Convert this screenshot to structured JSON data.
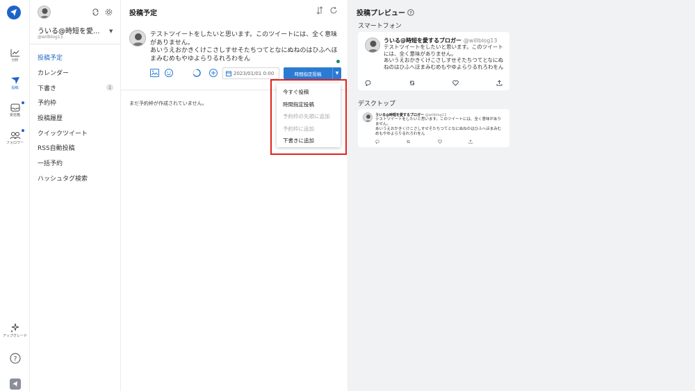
{
  "rail": {
    "items": [
      {
        "label": "分析"
      },
      {
        "label": "投稿"
      },
      {
        "label": "受信箱"
      },
      {
        "label": "フォロワー"
      }
    ],
    "upgrade_label": "アップグレード"
  },
  "sidebar": {
    "account_name": "ういる@時短を愛...",
    "handle": "@willblog13",
    "menu": [
      {
        "label": "投稿予定"
      },
      {
        "label": "カレンダー"
      },
      {
        "label": "下書き",
        "badge": "1"
      },
      {
        "label": "予約枠"
      },
      {
        "label": "投稿履歴"
      },
      {
        "label": "クイックツイート"
      },
      {
        "label": "RSS自動投稿"
      },
      {
        "label": "一括予約"
      },
      {
        "label": "ハッシュタグ検索"
      }
    ]
  },
  "composer": {
    "title": "投稿予定",
    "text": "テストツイートをしたいと思います。このツイートには、全く意味がありません。\nあいうえおかきくけこさしすせそたちつてとなにぬねのはひふへほまみむめもやゆよらりるれろわをん",
    "date_value": "2023/01/01 0:00",
    "schedule_button": "時間指定投稿",
    "empty_message": "まだ予約枠が作成されていません。",
    "dropdown": [
      {
        "label": "今すぐ投稿",
        "enabled": true
      },
      {
        "label": "時間指定投稿",
        "enabled": true
      },
      {
        "label": "予約枠の先頭に追加",
        "enabled": false
      },
      {
        "label": "予約枠に追加",
        "enabled": false
      },
      {
        "label": "下書きに追加",
        "enabled": true
      }
    ]
  },
  "preview": {
    "title": "投稿プレビュー",
    "smartphone_label": "スマートフォン",
    "desktop_label": "デスクトップ",
    "name": "ういる@時短を愛するブロガー",
    "handle": "@willblog13",
    "smartphone_text": "テストツイートをしたいと思います。このツイートには、全く意味がありません。\nあいうえおかきくけこさしすせそたちつてとなにぬねのはひふへほまみむめもやゆよらりるれろわをん",
    "desktop_text": "テストツイートをしたいと思います。このツイートには、全く意味がありません。\nあいうえおかきくけこさしすせそたちつてとなにぬねのはひふへほまみむめもやゆよらりるれろわをん"
  },
  "colors": {
    "accent": "#2b7bd3",
    "highlight": "#e0201e",
    "preview_bg": "#f1f2f4"
  }
}
